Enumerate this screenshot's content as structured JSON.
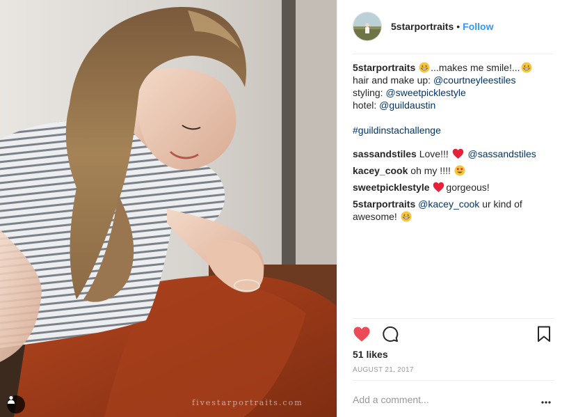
{
  "photo": {
    "watermark": "fivestarportraits.com",
    "tag_icon": "user-tag-icon"
  },
  "post": {
    "header": {
      "username": "5starportraits",
      "separator": "•",
      "follow_label": "Follow"
    },
    "caption": {
      "username": "5starportraits",
      "line1_text": "...makes me smile!...",
      "line2_prefix": "hair and make up: ",
      "line2_mention": "@courtneyleestiles",
      "line3_prefix": "styling: ",
      "line3_mention": "@sweetpicklestyle",
      "line4_prefix": "hotel: ",
      "line4_mention": "@guildaustin",
      "hashtag": "#guildinstachallenge"
    },
    "comments": [
      {
        "username": "sassandstiles",
        "text": "Love!!! ",
        "mention": "@sassandstiles"
      },
      {
        "username": "kacey_cook",
        "text": "oh my !!!! "
      },
      {
        "username": "sweetpicklestyle",
        "text": "gorgeous!"
      },
      {
        "username": "5starportraits",
        "mention": "@kacey_cook",
        "text": " ur kind of awesome! "
      }
    ],
    "likes": "51 likes",
    "date": "AUGUST 21, 2017",
    "add_comment_placeholder": "Add a comment...",
    "more_label": "•••",
    "colors": {
      "follow": "#3897f0",
      "mention": "#003569",
      "like_heart": "#ed4956",
      "emoji_heart": "#e8213b"
    },
    "icons": [
      "heart-icon",
      "comment-bubble-icon",
      "bookmark-icon",
      "more-dots-icon",
      "grinning-emoji-icon",
      "heart-emoji-icon",
      "heart-eyes-emoji-icon"
    ]
  }
}
